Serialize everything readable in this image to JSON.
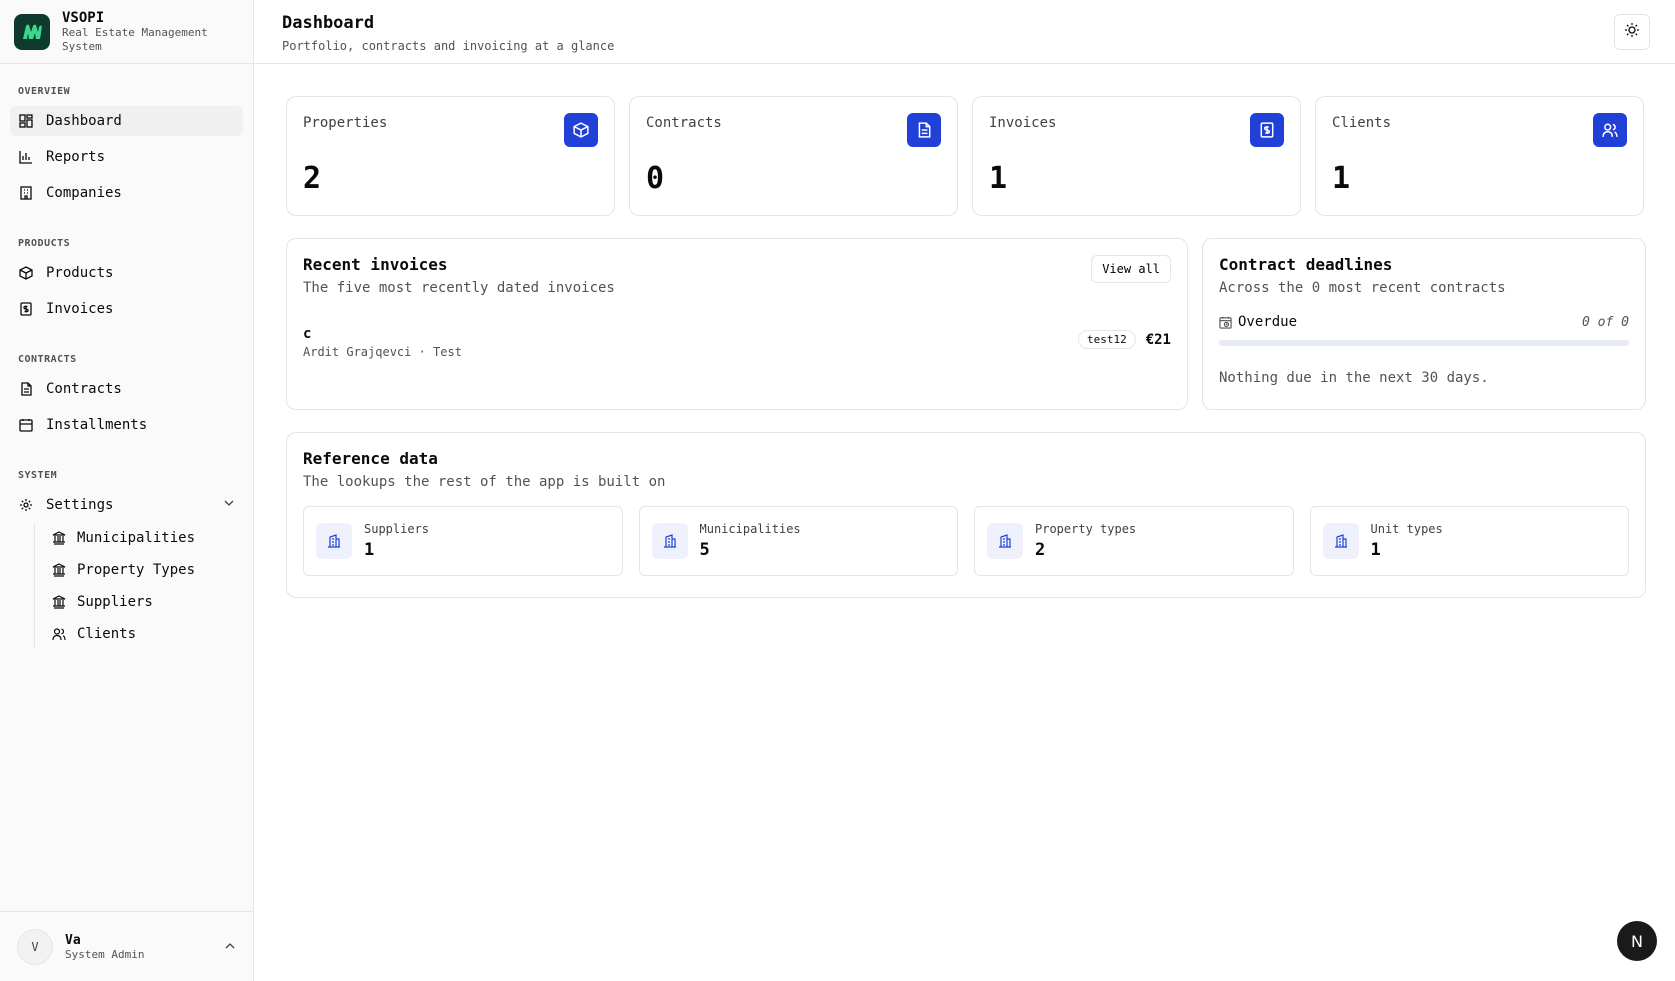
{
  "brand": {
    "name": "VSOPI",
    "subtitle": "Real Estate Management System"
  },
  "sidebar": {
    "sections": [
      {
        "heading": "OVERVIEW",
        "items": [
          {
            "label": "Dashboard",
            "icon": "dashboard-icon",
            "active": true
          },
          {
            "label": "Reports",
            "icon": "bar-chart-icon"
          },
          {
            "label": "Companies",
            "icon": "building-icon"
          }
        ]
      },
      {
        "heading": "PRODUCTS",
        "items": [
          {
            "label": "Products",
            "icon": "package-icon"
          },
          {
            "label": "Invoices",
            "icon": "receipt-icon"
          }
        ]
      },
      {
        "heading": "CONTRACTS",
        "items": [
          {
            "label": "Contracts",
            "icon": "file-text-icon"
          },
          {
            "label": "Installments",
            "icon": "calendar-icon"
          }
        ]
      },
      {
        "heading": "SYSTEM",
        "items": [
          {
            "label": "Settings",
            "icon": "gear-icon"
          }
        ]
      }
    ],
    "settings_sub": [
      {
        "label": "Municipalities",
        "icon": "landmark-icon"
      },
      {
        "label": "Property Types",
        "icon": "landmark-icon"
      },
      {
        "label": "Suppliers",
        "icon": "landmark-icon"
      },
      {
        "label": "Clients",
        "icon": "users-icon"
      }
    ]
  },
  "user": {
    "initial": "V",
    "name": "Va",
    "role": "System Admin"
  },
  "header": {
    "title": "Dashboard",
    "subtitle": "Portfolio, contracts and invoicing at a glance"
  },
  "stats": [
    {
      "label": "Properties",
      "value": "2",
      "icon": "cube-icon"
    },
    {
      "label": "Contracts",
      "value": "0",
      "icon": "file-text-icon"
    },
    {
      "label": "Invoices",
      "value": "1",
      "icon": "receipt-icon"
    },
    {
      "label": "Clients",
      "value": "1",
      "icon": "users-icon"
    }
  ],
  "recent_invoices": {
    "title": "Recent invoices",
    "subtitle": "The five most recently dated invoices",
    "view_all": "View all",
    "items": [
      {
        "title": "c",
        "meta": "Ardit Grajqevci · Test",
        "tag": "test12",
        "amount": "€21"
      }
    ]
  },
  "deadlines": {
    "title": "Contract deadlines",
    "subtitle": "Across the 0 most recent contracts",
    "overdue_label": "Overdue",
    "overdue_count": "0 of 0",
    "overdue_fraction": 0,
    "empty": "Nothing due in the next 30 days."
  },
  "reference": {
    "title": "Reference data",
    "subtitle": "The lookups the rest of the app is built on",
    "items": [
      {
        "label": "Suppliers",
        "value": "1"
      },
      {
        "label": "Municipalities",
        "value": "5"
      },
      {
        "label": "Property types",
        "value": "2"
      },
      {
        "label": "Unit types",
        "value": "1"
      }
    ]
  },
  "colors": {
    "accent": "#2140d8",
    "brand_bg": "#0f3b2e",
    "brand_mark": "#3ed68c"
  },
  "badge": "N"
}
